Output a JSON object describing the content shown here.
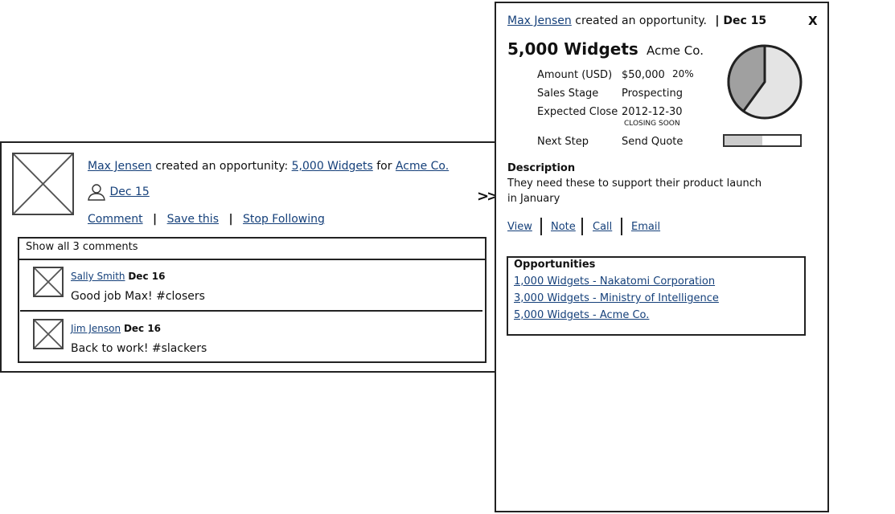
{
  "feed_item": {
    "author": "Max Jensen",
    "action_text": "created an opportunity:",
    "opportunity": "5,000 Widgets",
    "for_text": "for",
    "account": "Acme Co.",
    "date": "Dec 15",
    "actions": {
      "comment": "Comment",
      "save": "Save this",
      "stop": "Stop Following"
    },
    "show_all": "Show all 3 comments",
    "comments": [
      {
        "author": "Sally Smith",
        "date": "Dec 16",
        "text": "Good job Max! #closers"
      },
      {
        "author": "Jim Jenson",
        "date": "Dec 16",
        "text": "Back to work! #slackers"
      }
    ]
  },
  "arrow": ">>",
  "detail": {
    "author": "Max Jensen",
    "action_text": "created an opportunity.",
    "date": "| Dec 15",
    "close": "X",
    "title": "5,000 Widgets",
    "company": "Acme Co.",
    "fields": {
      "amount_label": "Amount (USD)",
      "amount_value": "$50,000",
      "amount_pct": "20%",
      "stage_label": "Sales Stage",
      "stage_value": "Prospecting",
      "close_label": "Expected Close",
      "close_value": "2012-12-30",
      "close_note": "CLOSING SOON",
      "next_label": "Next Step",
      "next_value": "Send Quote"
    },
    "pie_fraction": 0.4,
    "progress_fraction": 0.5,
    "description_label": "Description",
    "description_line1": "They need these to support their product launch",
    "description_line2": "in January",
    "actions": {
      "view": "View",
      "note": "Note",
      "call": "Call",
      "email": "Email"
    },
    "opportunities_label": "Opportunities",
    "opportunities": [
      "1,000 Widgets - Nakatomi Corporation",
      "3,000 Widgets - Ministry of Intelligence",
      "5,000 Widgets - Acme Co."
    ]
  },
  "colors": {
    "link": "#15407a",
    "border": "#222222",
    "pie_dark": "#a0a0a0",
    "pie_light": "#e4e4e4"
  }
}
